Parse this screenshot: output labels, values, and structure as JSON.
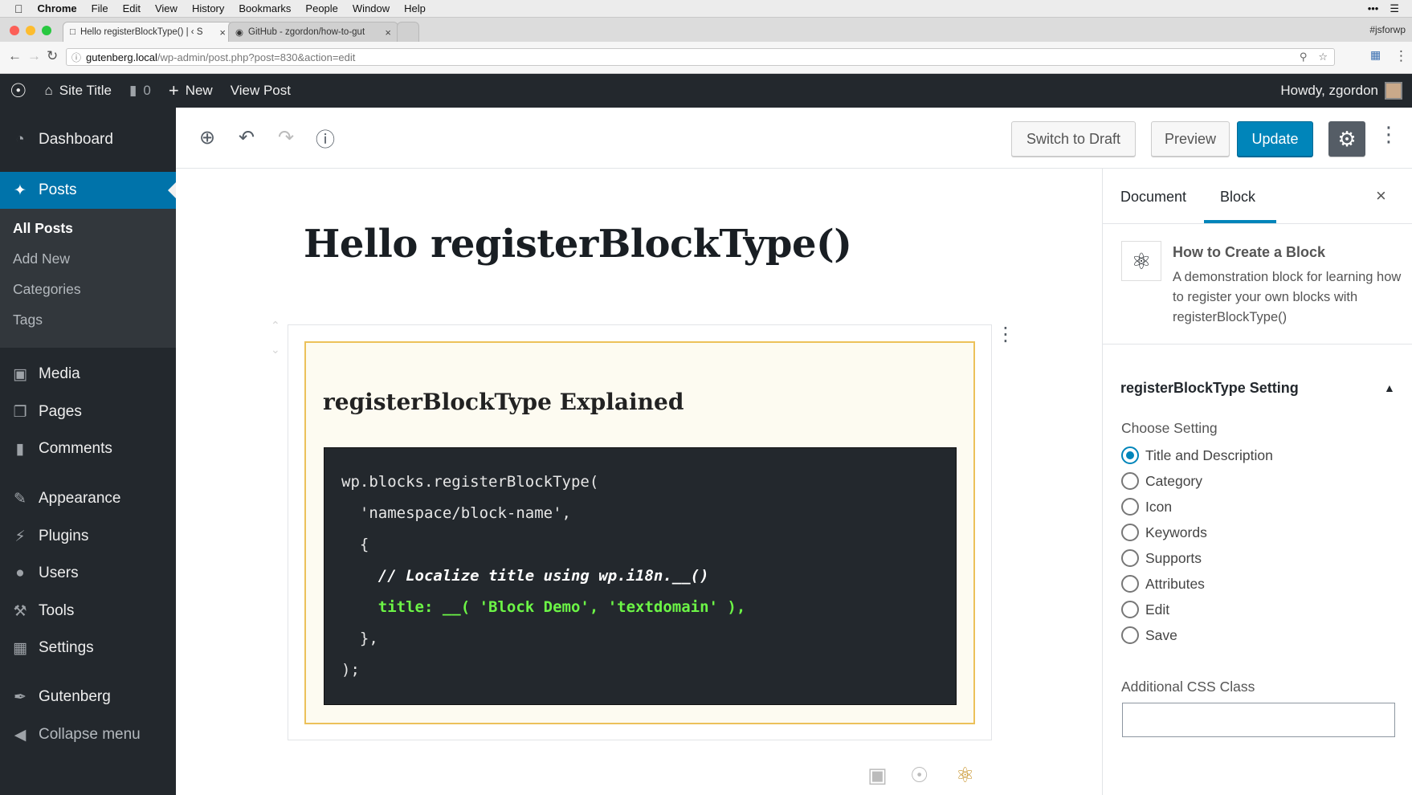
{
  "macbar": {
    "app": "Chrome",
    "menus": [
      "File",
      "Edit",
      "View",
      "History",
      "Bookmarks",
      "People",
      "Window",
      "Help"
    ]
  },
  "browser": {
    "tabs": [
      {
        "title": "Hello registerBlockType() | ‹ S",
        "active": true
      },
      {
        "title": "GitHub - zgordon/how-to-gut",
        "active": false
      }
    ],
    "profile_label": "#jsforwp",
    "url_host": "gutenberg.local",
    "url_path": "/wp-admin/post.php?post=830&action=edit"
  },
  "adminbar": {
    "site_title": "Site Title",
    "comments_count": "0",
    "new_label": "New",
    "view_post_label": "View Post",
    "howdy": "Howdy, zgordon"
  },
  "sidebar": {
    "items": [
      {
        "label": "Dashboard",
        "icon": "dashboard-icon"
      },
      {
        "label": "Posts",
        "icon": "pin-icon",
        "current": true
      },
      {
        "label": "Media",
        "icon": "media-icon"
      },
      {
        "label": "Pages",
        "icon": "pages-icon"
      },
      {
        "label": "Comments",
        "icon": "comments-icon"
      },
      {
        "label": "Appearance",
        "icon": "brush-icon"
      },
      {
        "label": "Plugins",
        "icon": "plug-icon"
      },
      {
        "label": "Users",
        "icon": "user-icon"
      },
      {
        "label": "Tools",
        "icon": "wrench-icon"
      },
      {
        "label": "Settings",
        "icon": "settings-icon"
      },
      {
        "label": "Gutenberg",
        "icon": "pen-icon"
      },
      {
        "label": "Collapse menu",
        "icon": "collapse-icon"
      }
    ],
    "submenu": [
      "All Posts",
      "Add New",
      "Categories",
      "Tags"
    ]
  },
  "editor": {
    "switch_to_draft": "Switch to Draft",
    "preview": "Preview",
    "update": "Update",
    "post_title": "Hello registerBlockType()",
    "block_heading": "registerBlockType Explained",
    "code_lines": [
      "wp.blocks.registerBlockType(",
      "  'namespace/block-name',",
      "  {",
      "    // Localize title using wp.i18n.__()",
      "    title: __( 'Block Demo', 'textdomain' ),",
      "  },",
      ");"
    ]
  },
  "inspector": {
    "tab_document": "Document",
    "tab_block": "Block",
    "block_name": "How to Create a Block",
    "block_description": "A demonstration block for learning how to register your own blocks with registerBlockType()",
    "panel_title": "registerBlockType Setting",
    "choose_label": "Choose Setting",
    "options": [
      "Title and Description",
      "Category",
      "Icon",
      "Keywords",
      "Supports",
      "Attributes",
      "Edit",
      "Save"
    ],
    "selected_option": "Title and Description",
    "css_class_label": "Additional CSS Class",
    "css_class_value": ""
  },
  "colors": {
    "admin_dark": "#23282d",
    "accent_blue": "#0073aa",
    "button_primary": "#0085ba",
    "block_border": "#ecc15a",
    "code_green": "#6cf546"
  }
}
